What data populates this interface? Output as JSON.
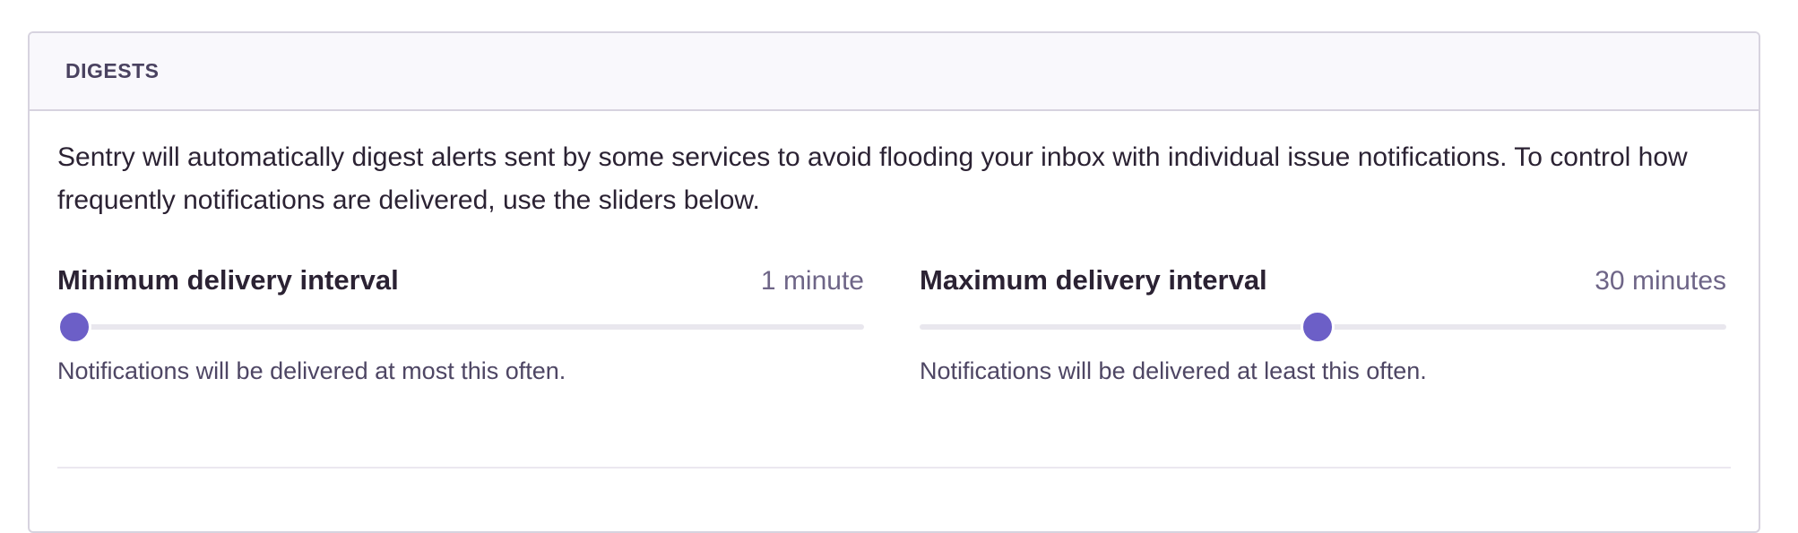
{
  "panel": {
    "title": "DIGESTS",
    "intro": "Sentry will automatically digest alerts sent by some services to avoid flooding your inbox with individual issue notifications. To control how frequently notifications are delivered, use the sliders below."
  },
  "fields": {
    "min": {
      "label": "Minimum delivery interval",
      "value": "1 minute",
      "help": "Notifications will be delivered at most this often.",
      "slider_position_fraction": 0.0
    },
    "max": {
      "label": "Maximum delivery interval",
      "value": "30 minutes",
      "help": "Notifications will be delivered at least this often.",
      "slider_position_fraction": 0.49
    }
  },
  "colors": {
    "accent": "#6c5fc7",
    "track": "#e9e7ee"
  }
}
